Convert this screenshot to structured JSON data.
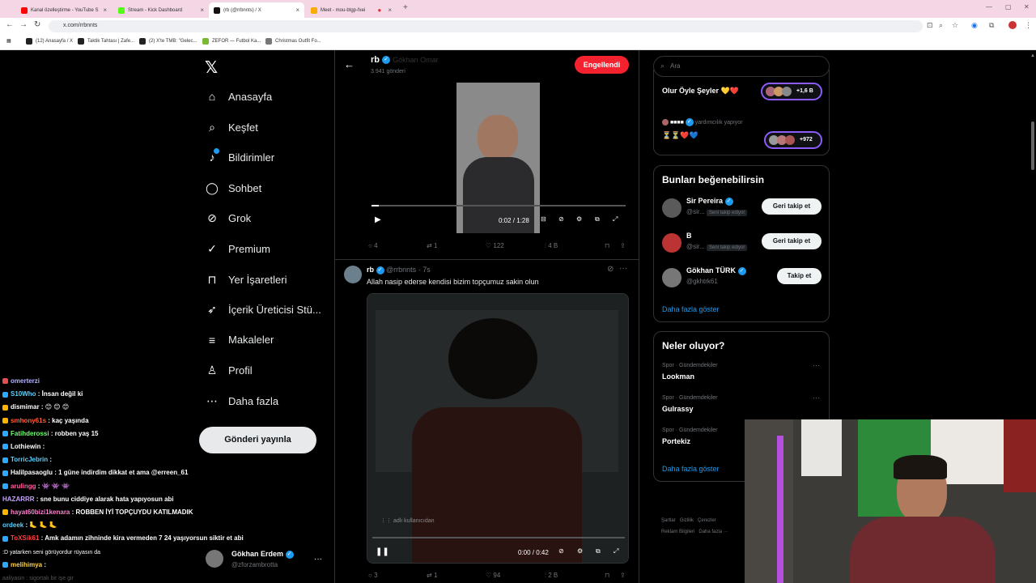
{
  "browser": {
    "tabs": [
      {
        "label": "Kanal özelleştirme - YouTube S",
        "color": "#ff0000"
      },
      {
        "label": "Stream - Kick Dashboard",
        "color": "#53fc18"
      },
      {
        "label": "(rb (@rrbnnts) / X",
        "color": "#111111"
      },
      {
        "label": "Meet - mou-btgp-fxei",
        "color": "#f9ab00"
      }
    ],
    "url": "x.com/rrbnnts",
    "bookmarks": [
      "(12) Anasayfa / X",
      "Taktik Tahtası | Zafe...",
      "(2) X'te TMB: \"Gelec...",
      "ZEFOR — Futbol Ka...",
      "Christmas Outfit Fo..."
    ]
  },
  "nav": {
    "items": [
      {
        "label": "Anasayfa",
        "icon": "home-icon",
        "glyph": "⌂"
      },
      {
        "label": "Keşfet",
        "icon": "search-icon",
        "glyph": "⌕"
      },
      {
        "label": "Bildirimler",
        "icon": "bell-icon",
        "glyph": "♪"
      },
      {
        "label": "Sohbet",
        "icon": "chat-icon",
        "glyph": "◯"
      },
      {
        "label": "Grok",
        "icon": "grok-icon",
        "glyph": "⊘"
      },
      {
        "label": "Premium",
        "icon": "premium-icon",
        "glyph": "✓"
      },
      {
        "label": "Yer İşaretleri",
        "icon": "bookmark-icon",
        "glyph": "⊓"
      },
      {
        "label": "İçerik Üreticisi Stü...",
        "icon": "rocket-icon",
        "glyph": "➶"
      },
      {
        "label": "Makaleler",
        "icon": "article-icon",
        "glyph": "≡"
      },
      {
        "label": "Profil",
        "icon": "profile-icon",
        "glyph": "♙"
      },
      {
        "label": "Daha fazla",
        "icon": "more-circle-icon",
        "glyph": "⋯"
      }
    ],
    "post_button": "Gönderi yayınla",
    "account": {
      "name": "Gökhan Erdem",
      "handle": "@zforzambrotta"
    }
  },
  "profile_header": {
    "name": "rb",
    "posts": "3.941 gönderi",
    "blocked_label": "Engellendi",
    "partial_overlay": "Gökhan Omar"
  },
  "tweet1": {
    "video_time": "0:02 / 1:28",
    "progress": 0.03,
    "stats": {
      "replies": "4",
      "retweets": "1",
      "likes": "122",
      "views": "4 B"
    }
  },
  "tweet2": {
    "name": "rb",
    "handle": "@rrbnnts",
    "time": "7s",
    "text": "Allah nasip ederse kendisi bizim topçumuz sakin olun",
    "video_time": "0:00 / 0:42",
    "progress": 0.0,
    "video_overlay": "adlı kullanıcıdan",
    "stats": {
      "replies": "3",
      "retweets": "1",
      "likes": "94",
      "views": "2 B"
    }
  },
  "right": {
    "search_placeholder": "Ara",
    "top_card": {
      "row1": {
        "title": "Olur Öyle Şeyler 💛❤️",
        "count": "+1,6 B"
      },
      "row2": {
        "sub": "yardımcılık yapıyor",
        "title": "⏳⏳❤️💙",
        "count": "+972",
        "prefix": "■■■■"
      }
    },
    "suggest": {
      "title": "Bunları beğenebilirsin",
      "users": [
        {
          "name": "Sir Pereira",
          "handle": "@sir...",
          "tag": "Seni takip ediyor",
          "btn": "Geri takip et"
        },
        {
          "name": "B",
          "handle": "@sir...",
          "tag": "Seni takip ediyor",
          "btn": "Geri takip et"
        },
        {
          "name": "Gökhan TÜRK",
          "handle": "@gkhtrk61",
          "tag": "",
          "btn": "Takip et"
        }
      ],
      "more": "Daha fazla göster"
    },
    "trends": {
      "title": "Neler oluyor?",
      "items": [
        {
          "cat": "Spor · Gündemdekiler",
          "name": "Lookman"
        },
        {
          "cat": "Spor · Gündemdekiler",
          "name": "Gulrassy"
        },
        {
          "cat": "Spor · Gündemdekiler",
          "name": "Portekiz"
        }
      ],
      "more": "Daha fazla göster"
    },
    "footer": [
      "Şartlar",
      "Gizlilik",
      "Çerezler",
      "Reklam Bilgileri",
      "Daha fazla ···"
    ]
  },
  "chat": [
    {
      "user": "omerterzi",
      "msg": "",
      "color": "#b4b4ff",
      "icon": "#e05050"
    },
    {
      "user": "S10Who",
      "msg": ": İnsan değil ki",
      "color": "#5ad1ff",
      "icon": "#2fa8ff"
    },
    {
      "user": "dismimar",
      "msg": ": 😊 😊 😊",
      "color": "#ffffff",
      "icon": "#ffb400"
    },
    {
      "user": "smhony61s",
      "msg": ": kaç yaşında",
      "color": "#ff5f3a",
      "icon": "#ffb400"
    },
    {
      "user": "Fatihderossi",
      "msg": ": robben yaş 15",
      "color": "#6fff6f",
      "icon": "#2fa8ff"
    },
    {
      "user": "Lothiewin",
      "msg": ":",
      "color": "#ffffff",
      "icon": "#2fa8ff"
    },
    {
      "user": "TorricJebrin",
      "msg": ":",
      "color": "#5ad1ff",
      "icon": "#2fa8ff"
    },
    {
      "user": "Halilpasaoglu",
      "msg": ": 1 güne indirdim dikkat et ama @erreen_61",
      "color": "#ffffff",
      "icon": "#2fa8ff"
    },
    {
      "user": "arulingg",
      "msg": ": 👾 👾 👾",
      "color": "#ff5fa0",
      "icon": "#2fa8ff"
    },
    {
      "user": "HAZARRR",
      "msg": ": sne bunu ciddiye alarak hata yapıyosun abi",
      "color": "#c8a0ff",
      "icon": ""
    },
    {
      "user": "hayat60bizi1kenara",
      "msg": ": ROBBEN İYİ TOPÇUYDU KATILMADIK",
      "color": "#ff7fd0",
      "icon": "#ffb400"
    },
    {
      "user": "ordeek",
      "msg": ": 🦶 🦶 🦶",
      "color": "#5ad1ff",
      "icon": ""
    },
    {
      "user": "ToXSik61",
      "msg": ": Amk adamın zihninde kira vermeden 7 24 yaşıyorsun siktir et abi",
      "color": "#ff4040",
      "icon": "#2fa8ff"
    },
    {
      "user": "",
      "msg": ":D yatarken seni görüyordur rüyasın da",
      "color": "#ffffff",
      "icon": ""
    },
    {
      "user": "melihimya",
      "msg": ":",
      "color": "#ffd24a",
      "icon": "#2fa8ff"
    },
    {
      "user": "",
      "msg": "aaliyasin : sigortalı bir işe gir",
      "color": "#555555",
      "icon": ""
    }
  ]
}
